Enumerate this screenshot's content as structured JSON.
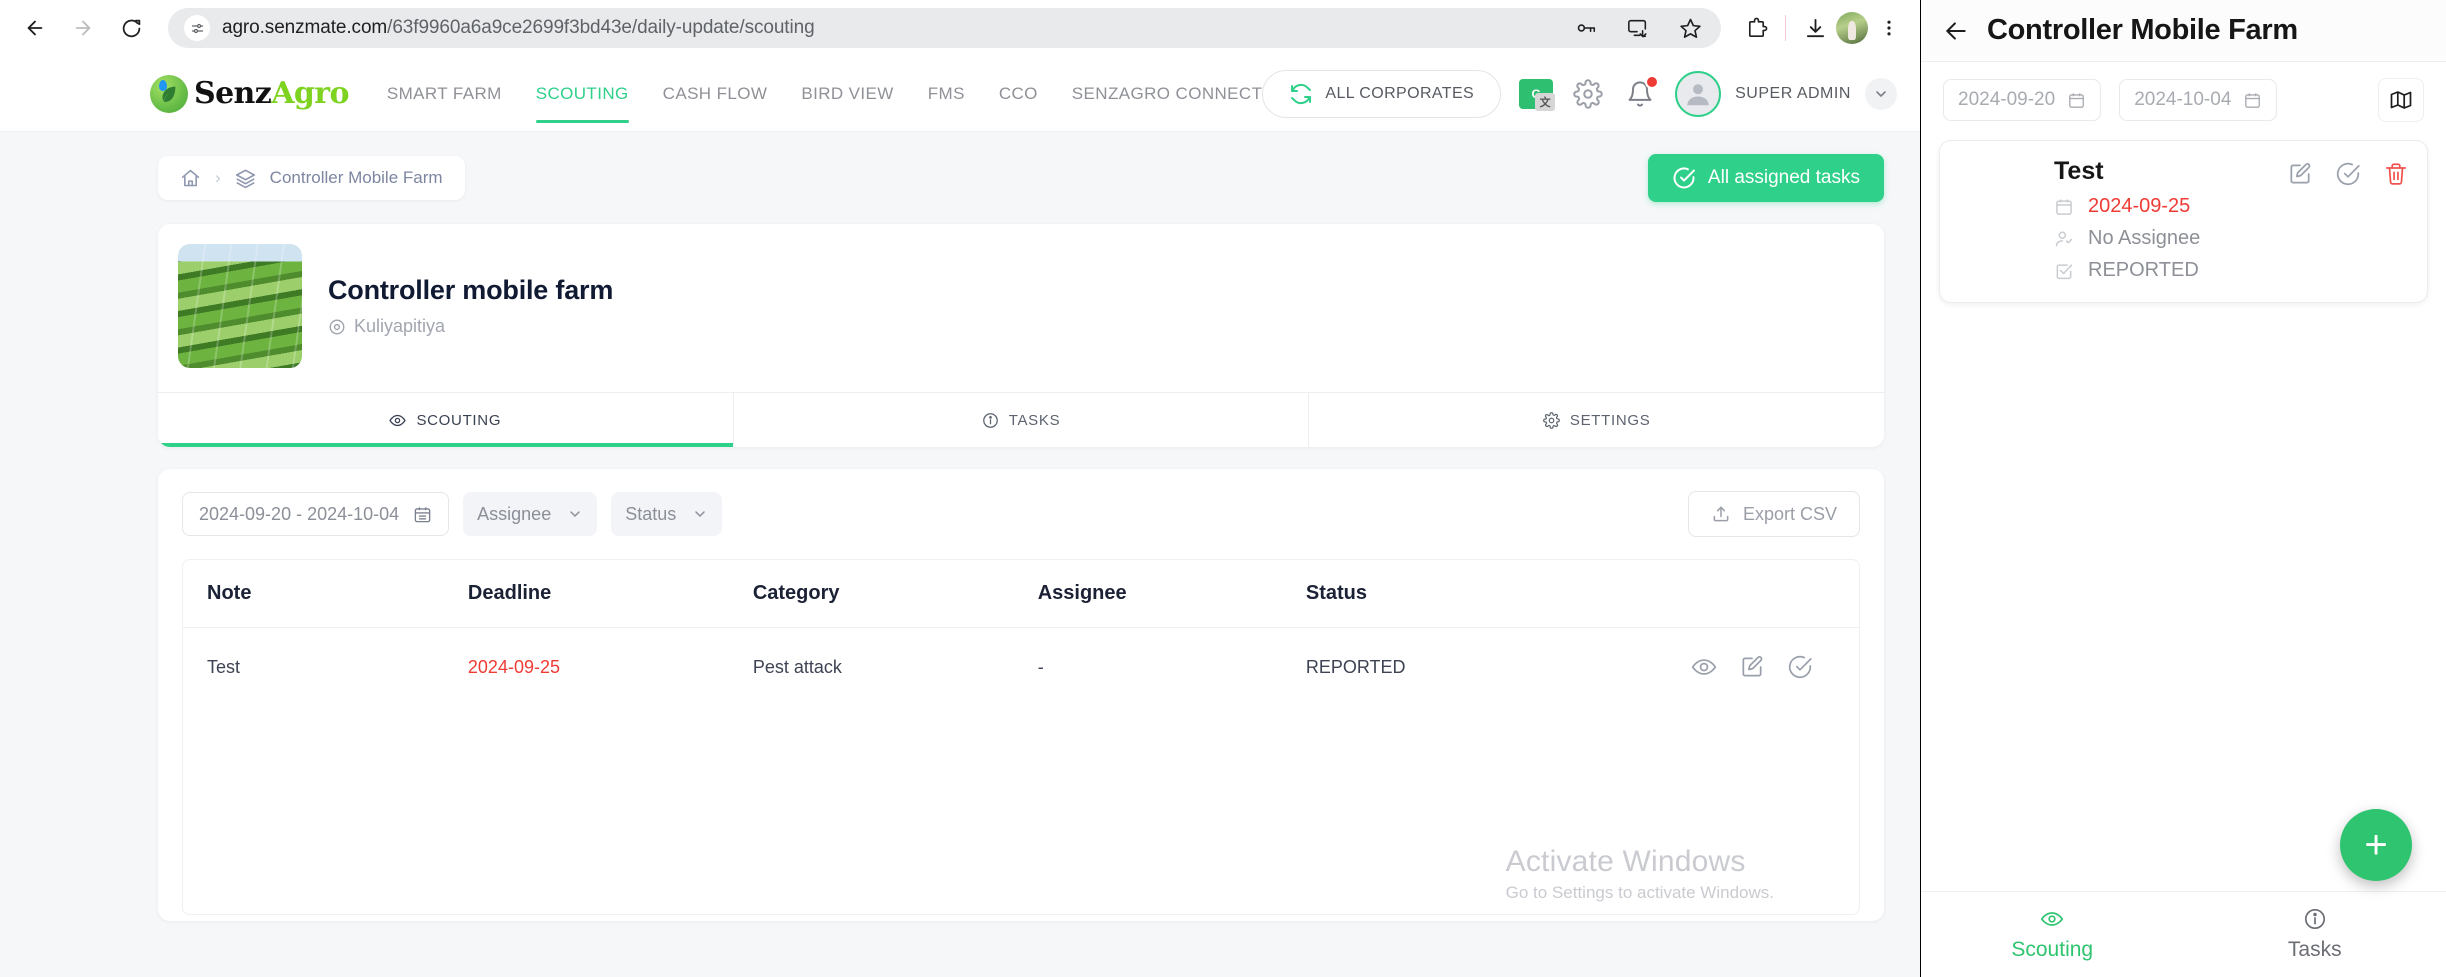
{
  "browser": {
    "url_host": "agro.senzmate.com",
    "url_path": "/63f9960a6a9ce2699f3bd43e/daily-update/scouting",
    "back_icon": "back-arrow-icon",
    "forward_icon": "forward-arrow-icon",
    "reload_icon": "reload-icon",
    "site_info_icon": "site-settings-icon",
    "password_icon": "password-key-icon",
    "cast_icon": "cast-save-icon",
    "bookmark_icon": "star-bookmark-icon",
    "extensions_icon": "extensions-puzzle-icon",
    "downloads_icon": "downloads-icon",
    "profile_icon": "profile-avatar-icon",
    "menu_icon": "three-dot-menu-icon"
  },
  "app": {
    "brand": {
      "first": "Senz",
      "second": "Agro"
    },
    "nav": [
      {
        "label": "SMART FARM",
        "active": false
      },
      {
        "label": "SCOUTING",
        "active": true
      },
      {
        "label": "CASH FLOW",
        "active": false
      },
      {
        "label": "BIRD VIEW",
        "active": false
      },
      {
        "label": "FMS",
        "active": false
      },
      {
        "label": "CCO",
        "active": false
      },
      {
        "label": "SENZAGRO CONNECT",
        "active": false
      }
    ],
    "corporates_button": "ALL CORPORATES",
    "translate_label": "G",
    "user_name": "SUPER ADMIN",
    "accent_color": "#2fd08a",
    "danger_color": "#ef3b36"
  },
  "breadcrumb": {
    "home_icon": "home-icon",
    "separator": "›",
    "current": "Controller Mobile Farm"
  },
  "assigned_tasks_button": "All assigned tasks",
  "farm": {
    "name": "Controller mobile farm",
    "location": "Kuliyapitiya"
  },
  "tabs": [
    {
      "label": "SCOUTING",
      "icon": "eye-icon",
      "active": true
    },
    {
      "label": "TASKS",
      "icon": "info-circle-icon",
      "active": false
    },
    {
      "label": "SETTINGS",
      "icon": "gear-icon",
      "active": false
    }
  ],
  "filters": {
    "date_range": "2024-09-20 - 2024-10-04",
    "assignee_label": "Assignee",
    "status_label": "Status",
    "export_label": "Export CSV"
  },
  "table": {
    "columns": [
      "Note",
      "Deadline",
      "Category",
      "Assignee",
      "Status",
      ""
    ],
    "rows": [
      {
        "note": "Test",
        "deadline": "2024-09-25",
        "category": "Pest attack",
        "assignee": "-",
        "status": "REPORTED",
        "actions": [
          "view-icon",
          "edit-icon",
          "complete-icon"
        ]
      }
    ]
  },
  "watermark": {
    "line1": "Activate Windows",
    "line2": "Go to Settings to activate Windows."
  },
  "mobile": {
    "title": "Controller Mobile Farm",
    "back_icon": "back-arrow-icon",
    "date_from": "2024-09-20",
    "date_to": "2024-10-04",
    "map_icon": "map-icon",
    "card": {
      "title": "Test",
      "date": "2024-09-25",
      "assignee": "No Assignee",
      "status": "REPORTED",
      "actions": [
        "edit-icon",
        "complete-icon",
        "delete-icon"
      ]
    },
    "fab_label": "+",
    "bottom_nav": [
      {
        "label": "Scouting",
        "icon": "eye-icon",
        "active": true
      },
      {
        "label": "Tasks",
        "icon": "info-circle-icon",
        "active": false
      }
    ]
  }
}
